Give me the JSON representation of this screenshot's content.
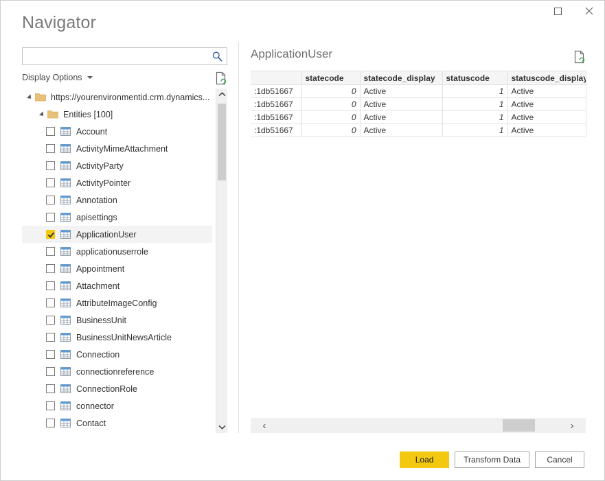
{
  "window": {
    "title": "Navigator",
    "maximize_label": "Maximize",
    "close_label": "Close"
  },
  "search": {
    "value": "",
    "placeholder": ""
  },
  "toolbar": {
    "display_options_label": "Display Options",
    "refresh_tooltip": "Refresh"
  },
  "tree": {
    "root": {
      "label": "https://yourenvironmentid.crm.dynamics...",
      "expanded": true
    },
    "group": {
      "label": "Entities [100]",
      "expanded": true
    },
    "items": [
      {
        "label": "Account",
        "checked": false
      },
      {
        "label": "ActivityMimeAttachment",
        "checked": false
      },
      {
        "label": "ActivityParty",
        "checked": false
      },
      {
        "label": "ActivityPointer",
        "checked": false
      },
      {
        "label": "Annotation",
        "checked": false
      },
      {
        "label": "apisettings",
        "checked": false
      },
      {
        "label": "ApplicationUser",
        "checked": true
      },
      {
        "label": "applicationuserrole",
        "checked": false
      },
      {
        "label": "Appointment",
        "checked": false
      },
      {
        "label": "Attachment",
        "checked": false
      },
      {
        "label": "AttributeImageConfig",
        "checked": false
      },
      {
        "label": "BusinessUnit",
        "checked": false
      },
      {
        "label": "BusinessUnitNewsArticle",
        "checked": false
      },
      {
        "label": "Connection",
        "checked": false
      },
      {
        "label": "connectionreference",
        "checked": false
      },
      {
        "label": "ConnectionRole",
        "checked": false
      },
      {
        "label": "connector",
        "checked": false
      },
      {
        "label": "Contact",
        "checked": false
      }
    ]
  },
  "preview": {
    "title": "ApplicationUser",
    "columns": [
      "",
      "statecode",
      "statecode_display",
      "statuscode",
      "statuscode_display"
    ],
    "rows": [
      [
        ":1db51667",
        "0",
        "Active",
        "1",
        "Active"
      ],
      [
        ":1db51667",
        "0",
        "Active",
        "1",
        "Active"
      ],
      [
        ":1db51667",
        "0",
        "Active",
        "1",
        "Active"
      ],
      [
        ":1db51667",
        "0",
        "Active",
        "1",
        "Active"
      ]
    ]
  },
  "scrollbars": {
    "h_left_arrow": "‹",
    "h_right_arrow": "›"
  },
  "footer": {
    "load_label": "Load",
    "transform_label": "Transform Data",
    "cancel_label": "Cancel"
  },
  "colors": {
    "accent": "#f2c811",
    "title_text": "#7a7a7a",
    "border": "#cccccc",
    "header_bg": "#f5f5f5"
  }
}
